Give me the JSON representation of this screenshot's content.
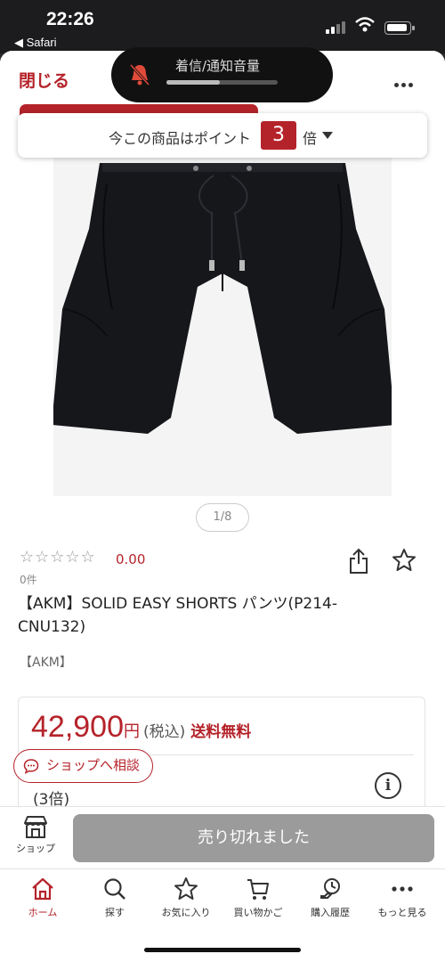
{
  "status_bar": {
    "time": "22:26",
    "back_label": "◀ Safari"
  },
  "header": {
    "close_label": "閉じる"
  },
  "volume_hud": {
    "label": "着信/通知音量",
    "level_percent": 48
  },
  "points_banner": {
    "text": "今この商品はポイント",
    "multiplier": "3",
    "suffix": "倍"
  },
  "gallery": {
    "counter": "1/8"
  },
  "rating": {
    "stars": "☆☆☆☆☆",
    "value": "0.00",
    "review_count": "0件"
  },
  "product": {
    "title": "【AKM】SOLID EASY SHORTS パンツ(P214-CNU132)",
    "brand": "【AKM】"
  },
  "price": {
    "value": "42,900",
    "unit": "円",
    "tax_label": "(税込)",
    "shipping_label": "送料無料",
    "points_multiplier": "(3倍)",
    "info_label": "i"
  },
  "consult_button": {
    "label": "ショップへ相談"
  },
  "purchase_bar": {
    "shop_label": "ショップ",
    "soldout_label": "売り切れました"
  },
  "tabs": [
    {
      "label": "ホーム",
      "icon": "home-icon",
      "active": true
    },
    {
      "label": "探す",
      "icon": "search-icon",
      "active": false
    },
    {
      "label": "お気に入り",
      "icon": "star-icon",
      "active": false
    },
    {
      "label": "買い物かご",
      "icon": "cart-icon",
      "active": false
    },
    {
      "label": "購入履歴",
      "icon": "history-icon",
      "active": false
    },
    {
      "label": "もっと見る",
      "icon": "more-icon",
      "active": false
    }
  ],
  "colors": {
    "brand_red": "#b5232a",
    "soldout_gray": "#9b9b9b"
  }
}
